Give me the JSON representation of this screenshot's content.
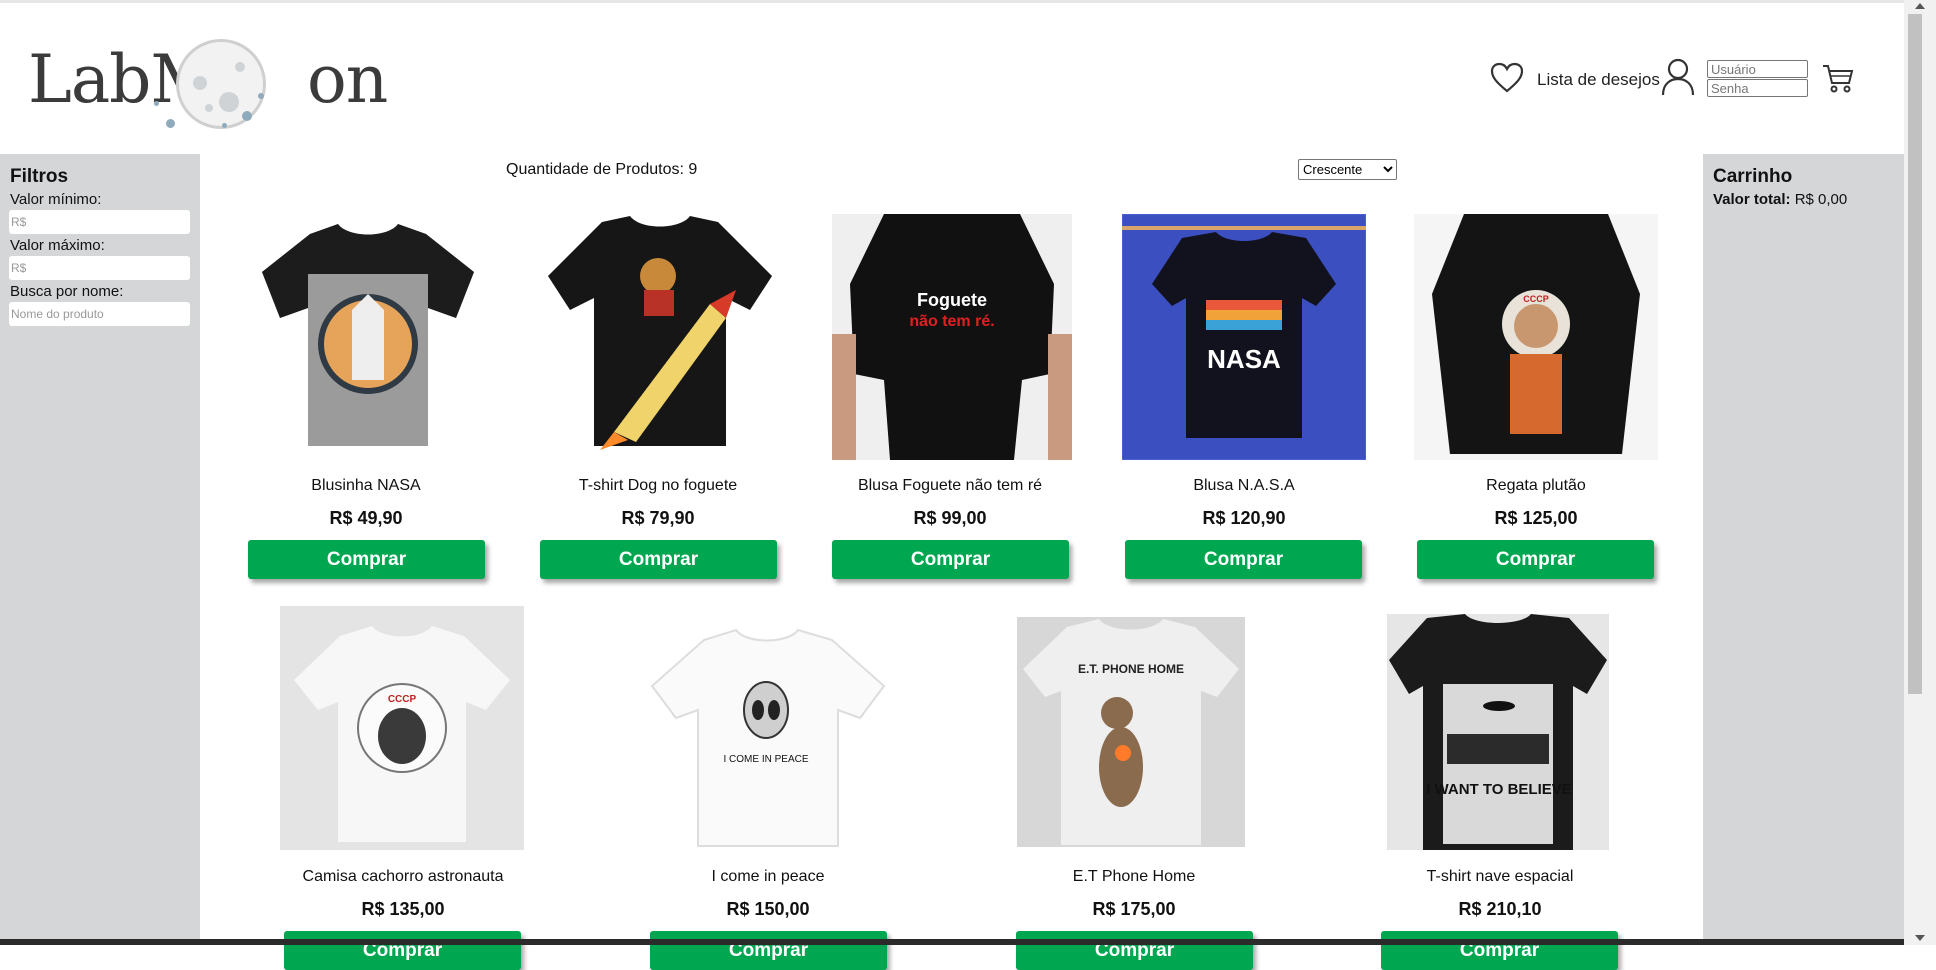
{
  "header": {
    "logo_text_left": "LabM",
    "logo_text_right": "on",
    "wishlist_label": "Lista de desejos",
    "login": {
      "user_placeholder": "Usuário",
      "pass_placeholder": "Senha"
    }
  },
  "filters": {
    "title": "Filtros",
    "min_label": "Valor mínimo:",
    "min_placeholder": "R$",
    "max_label": "Valor máximo:",
    "max_placeholder": "R$",
    "name_label": "Busca por nome:",
    "name_placeholder": "Nome do produto"
  },
  "main": {
    "quantity_text": "Quantidade de Produtos: 9",
    "sort_selected": "Crescente"
  },
  "products": [
    {
      "name": "Blusinha NASA",
      "price": "R$ 49,90",
      "button": "Comprar"
    },
    {
      "name": "T-shirt Dog no foguete",
      "price": "R$ 79,90",
      "button": "Comprar"
    },
    {
      "name": "Blusa Foguete não tem ré",
      "price": "R$ 99,00",
      "button": "Comprar"
    },
    {
      "name": "Blusa N.A.S.A",
      "price": "R$ 120,90",
      "button": "Comprar"
    },
    {
      "name": "Regata plutão",
      "price": "R$ 125,00",
      "button": "Comprar"
    },
    {
      "name": "Camisa cachorro astronauta",
      "price": "R$ 135,00",
      "button": "Comprar"
    },
    {
      "name": "I come in peace",
      "price": "R$ 150,00",
      "button": "Comprar"
    },
    {
      "name": "E.T Phone Home",
      "price": "R$ 175,00",
      "button": "Comprar"
    },
    {
      "name": "T-shirt nave espacial",
      "price": "R$ 210,10",
      "button": "Comprar"
    }
  ],
  "shirt_prints": {
    "p2": "Foguete",
    "p2b": "não tem ré.",
    "p3": "NASA",
    "p5": "CCCP",
    "p6": "I COME IN PEACE",
    "p7": "E.T. PHONE HOME",
    "p8": "I WANT TO BELIEVE"
  },
  "cart": {
    "title": "Carrinho",
    "total_label": "Valor total:",
    "total_value": "R$ 0,00"
  },
  "colors": {
    "buy_button": "#00a650",
    "side_panel": "#d4d6d8"
  },
  "icons": [
    "heart-icon",
    "user-icon",
    "cart-icon"
  ]
}
